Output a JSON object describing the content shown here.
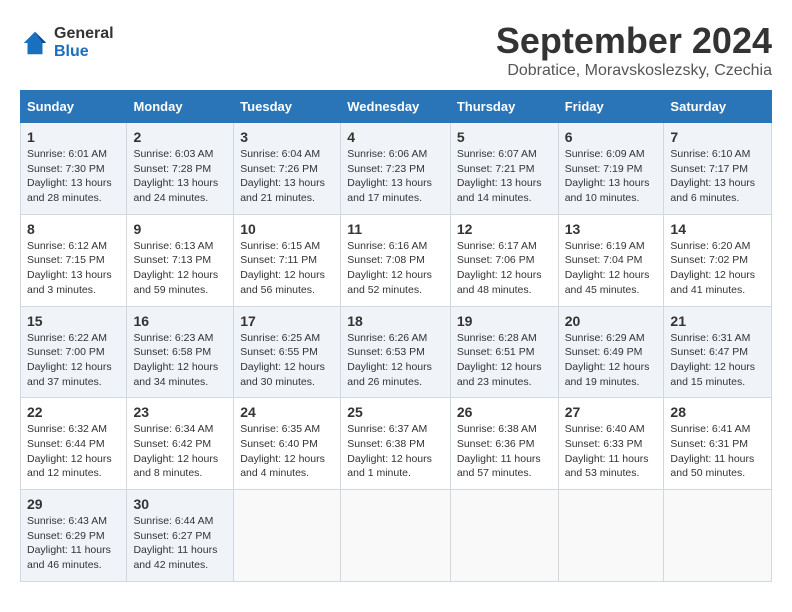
{
  "header": {
    "logo_line1": "General",
    "logo_line2": "Blue",
    "title": "September 2024",
    "subtitle": "Dobratice, Moravskoslezsky, Czechia"
  },
  "calendar": {
    "headers": [
      "Sunday",
      "Monday",
      "Tuesday",
      "Wednesday",
      "Thursday",
      "Friday",
      "Saturday"
    ],
    "weeks": [
      [
        {
          "day": "",
          "info": ""
        },
        {
          "day": "2",
          "info": "Sunrise: 6:03 AM\nSunset: 7:28 PM\nDaylight: 13 hours\nand 24 minutes."
        },
        {
          "day": "3",
          "info": "Sunrise: 6:04 AM\nSunset: 7:26 PM\nDaylight: 13 hours\nand 21 minutes."
        },
        {
          "day": "4",
          "info": "Sunrise: 6:06 AM\nSunset: 7:23 PM\nDaylight: 13 hours\nand 17 minutes."
        },
        {
          "day": "5",
          "info": "Sunrise: 6:07 AM\nSunset: 7:21 PM\nDaylight: 13 hours\nand 14 minutes."
        },
        {
          "day": "6",
          "info": "Sunrise: 6:09 AM\nSunset: 7:19 PM\nDaylight: 13 hours\nand 10 minutes."
        },
        {
          "day": "7",
          "info": "Sunrise: 6:10 AM\nSunset: 7:17 PM\nDaylight: 13 hours\nand 6 minutes."
        }
      ],
      [
        {
          "day": "1",
          "info": "Sunrise: 6:01 AM\nSunset: 7:30 PM\nDaylight: 13 hours\nand 28 minutes.",
          "first_week_sunday": true
        },
        {
          "day": "8",
          "info": "Sunrise: 6:12 AM\nSunset: 7:15 PM\nDaylight: 13 hours\nand 3 minutes."
        },
        {
          "day": "9",
          "info": "Sunrise: 6:13 AM\nSunset: 7:13 PM\nDaylight: 12 hours\nand 59 minutes."
        },
        {
          "day": "10",
          "info": "Sunrise: 6:15 AM\nSunset: 7:11 PM\nDaylight: 12 hours\nand 56 minutes."
        },
        {
          "day": "11",
          "info": "Sunrise: 6:16 AM\nSunset: 7:08 PM\nDaylight: 12 hours\nand 52 minutes."
        },
        {
          "day": "12",
          "info": "Sunrise: 6:17 AM\nSunset: 7:06 PM\nDaylight: 12 hours\nand 48 minutes."
        },
        {
          "day": "13",
          "info": "Sunrise: 6:19 AM\nSunset: 7:04 PM\nDaylight: 12 hours\nand 45 minutes."
        },
        {
          "day": "14",
          "info": "Sunrise: 6:20 AM\nSunset: 7:02 PM\nDaylight: 12 hours\nand 41 minutes."
        }
      ],
      [
        {
          "day": "15",
          "info": "Sunrise: 6:22 AM\nSunset: 7:00 PM\nDaylight: 12 hours\nand 37 minutes."
        },
        {
          "day": "16",
          "info": "Sunrise: 6:23 AM\nSunset: 6:58 PM\nDaylight: 12 hours\nand 34 minutes."
        },
        {
          "day": "17",
          "info": "Sunrise: 6:25 AM\nSunset: 6:55 PM\nDaylight: 12 hours\nand 30 minutes."
        },
        {
          "day": "18",
          "info": "Sunrise: 6:26 AM\nSunset: 6:53 PM\nDaylight: 12 hours\nand 26 minutes."
        },
        {
          "day": "19",
          "info": "Sunrise: 6:28 AM\nSunset: 6:51 PM\nDaylight: 12 hours\nand 23 minutes."
        },
        {
          "day": "20",
          "info": "Sunrise: 6:29 AM\nSunset: 6:49 PM\nDaylight: 12 hours\nand 19 minutes."
        },
        {
          "day": "21",
          "info": "Sunrise: 6:31 AM\nSunset: 6:47 PM\nDaylight: 12 hours\nand 15 minutes."
        }
      ],
      [
        {
          "day": "22",
          "info": "Sunrise: 6:32 AM\nSunset: 6:44 PM\nDaylight: 12 hours\nand 12 minutes."
        },
        {
          "day": "23",
          "info": "Sunrise: 6:34 AM\nSunset: 6:42 PM\nDaylight: 12 hours\nand 8 minutes."
        },
        {
          "day": "24",
          "info": "Sunrise: 6:35 AM\nSunset: 6:40 PM\nDaylight: 12 hours\nand 4 minutes."
        },
        {
          "day": "25",
          "info": "Sunrise: 6:37 AM\nSunset: 6:38 PM\nDaylight: 12 hours\nand 1 minute."
        },
        {
          "day": "26",
          "info": "Sunrise: 6:38 AM\nSunset: 6:36 PM\nDaylight: 11 hours\nand 57 minutes."
        },
        {
          "day": "27",
          "info": "Sunrise: 6:40 AM\nSunset: 6:33 PM\nDaylight: 11 hours\nand 53 minutes."
        },
        {
          "day": "28",
          "info": "Sunrise: 6:41 AM\nSunset: 6:31 PM\nDaylight: 11 hours\nand 50 minutes."
        }
      ],
      [
        {
          "day": "29",
          "info": "Sunrise: 6:43 AM\nSunset: 6:29 PM\nDaylight: 11 hours\nand 46 minutes."
        },
        {
          "day": "30",
          "info": "Sunrise: 6:44 AM\nSunset: 6:27 PM\nDaylight: 11 hours\nand 42 minutes."
        },
        {
          "day": "",
          "info": ""
        },
        {
          "day": "",
          "info": ""
        },
        {
          "day": "",
          "info": ""
        },
        {
          "day": "",
          "info": ""
        },
        {
          "day": "",
          "info": ""
        }
      ]
    ]
  }
}
